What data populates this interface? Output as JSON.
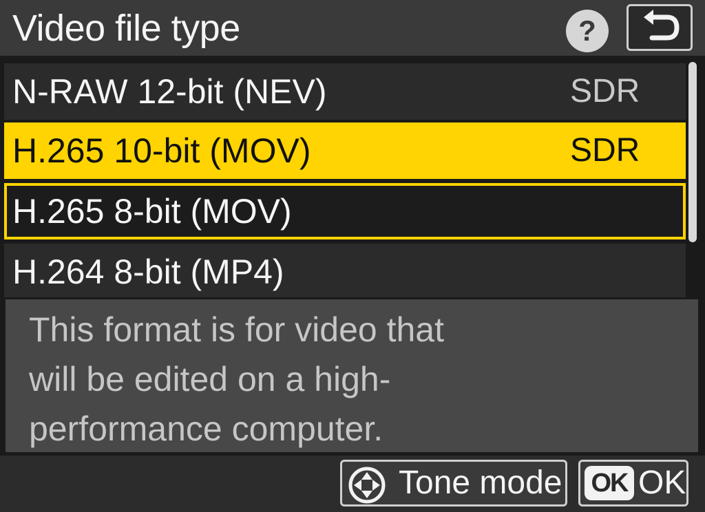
{
  "header": {
    "title": "Video file type",
    "help_label": "?",
    "back_icon": "return-arrow-icon"
  },
  "menu": {
    "items": [
      {
        "label": "N-RAW 12-bit (NEV)",
        "badge": "SDR",
        "state": "normal"
      },
      {
        "label": "H.265 10-bit (MOV)",
        "badge": "SDR",
        "state": "selected"
      },
      {
        "label": "H.265 8-bit (MOV)",
        "badge": "",
        "state": "outlined"
      },
      {
        "label": "H.264 8-bit (MP4)",
        "badge": "",
        "state": "normal"
      }
    ]
  },
  "description": {
    "lines": [
      "This format is for video that",
      "will be edited on a high-",
      "performance computer."
    ]
  },
  "footer": {
    "tone_mode_label": "Tone mode",
    "tone_mode_icon": "multi-selector-icon",
    "ok_icon_label": "OK",
    "ok_label": "OK"
  },
  "colors": {
    "highlight": "#ffd400",
    "header_bg": "#3a3a3a",
    "item_bg": "#2b2b2b",
    "description_bg": "#484848",
    "description_text": "#c6c6c6"
  }
}
